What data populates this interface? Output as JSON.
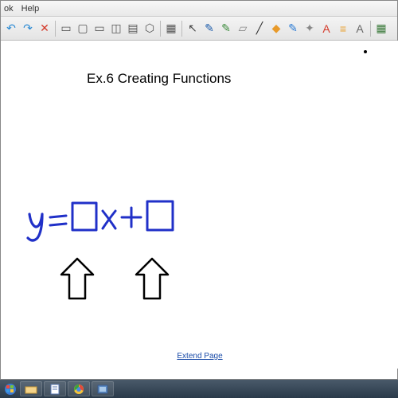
{
  "menubar": {
    "items": [
      "ok",
      "Help"
    ]
  },
  "toolbar": {
    "icons": [
      {
        "name": "undo-icon",
        "glyph": "↶",
        "color": "#2a8ad4"
      },
      {
        "name": "redo-icon",
        "glyph": "↷",
        "color": "#2a8ad4"
      },
      {
        "name": "delete-icon",
        "glyph": "✕",
        "color": "#d43a2a"
      },
      {
        "name": "sep"
      },
      {
        "name": "screen-icon",
        "glyph": "▭",
        "color": "#555"
      },
      {
        "name": "screen2-icon",
        "glyph": "▢",
        "color": "#555"
      },
      {
        "name": "screen3-icon",
        "glyph": "▭",
        "color": "#555"
      },
      {
        "name": "capture-icon",
        "glyph": "◫",
        "color": "#555"
      },
      {
        "name": "doc-icon",
        "glyph": "▤",
        "color": "#555"
      },
      {
        "name": "shape-icon",
        "glyph": "⬡",
        "color": "#555"
      },
      {
        "name": "sep"
      },
      {
        "name": "table-icon",
        "glyph": "▦",
        "color": "#555"
      },
      {
        "name": "sep"
      },
      {
        "name": "select-icon",
        "glyph": "↖",
        "color": "#444"
      },
      {
        "name": "pen-icon",
        "glyph": "✎",
        "color": "#1a5aaa"
      },
      {
        "name": "pen2-icon",
        "glyph": "✎",
        "color": "#3a8a3a"
      },
      {
        "name": "eraser-icon",
        "glyph": "▱",
        "color": "#888"
      },
      {
        "name": "line-icon",
        "glyph": "╱",
        "color": "#333"
      },
      {
        "name": "shape2-icon",
        "glyph": "◆",
        "color": "#e89a2a"
      },
      {
        "name": "pen3-icon",
        "glyph": "✎",
        "color": "#2a7ad4"
      },
      {
        "name": "magic-icon",
        "glyph": "✦",
        "color": "#888"
      },
      {
        "name": "text-icon",
        "glyph": "A",
        "color": "#d43a2a"
      },
      {
        "name": "format-icon",
        "glyph": "≡",
        "color": "#e8a030"
      },
      {
        "name": "text2-icon",
        "glyph": "A",
        "color": "#666"
      },
      {
        "name": "sep"
      },
      {
        "name": "props-icon",
        "glyph": "▦",
        "color": "#3a7a3a"
      }
    ]
  },
  "page": {
    "title": "Ex.6 Creating Functions",
    "extend_link": "Extend Page",
    "equation": {
      "y": "y",
      "eq": "=",
      "x": "x",
      "plus": "+"
    }
  },
  "taskbar": {
    "start": "start",
    "apps": [
      "explorer",
      "notebook",
      "chrome",
      "gallery"
    ]
  }
}
